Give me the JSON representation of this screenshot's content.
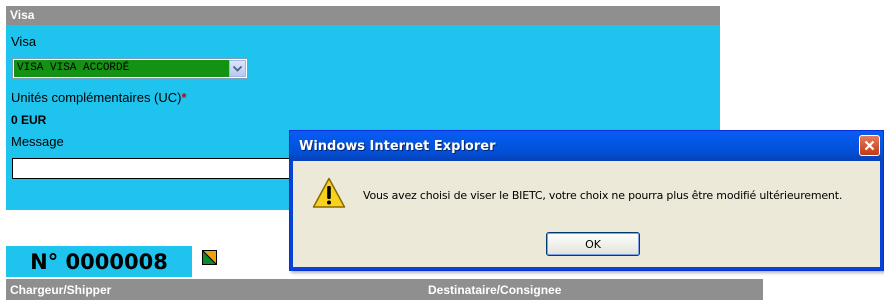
{
  "visa_panel": {
    "header": "Visa",
    "visa_label": "Visa",
    "visa_select_value": "VISA VISA ACCORDÉ",
    "uc_label": "Unités complémentaires (UC)",
    "uc_required_mark": "*",
    "uc_value": "0 EUR",
    "message_label": "Message",
    "message_value": ""
  },
  "record": {
    "number": "N° 0000008",
    "status_icon": "flag-icon"
  },
  "table_header": {
    "shipper": "Chargeur/Shipper",
    "consignee": "Destinataire/Consignee"
  },
  "dialog": {
    "title": "Windows Internet Explorer",
    "message": "Vous avez choisi de viser le BIETC, votre choix ne pourra plus être modifié ultérieurement.",
    "ok_label": "OK",
    "icon": "warning-icon"
  },
  "colors": {
    "panel_background": "#1ec4ee",
    "header_gray": "#8f8f8f",
    "select_highlight": "#149214",
    "dialog_titlebar": "#0458e8",
    "dialog_body": "#ece9d8"
  }
}
